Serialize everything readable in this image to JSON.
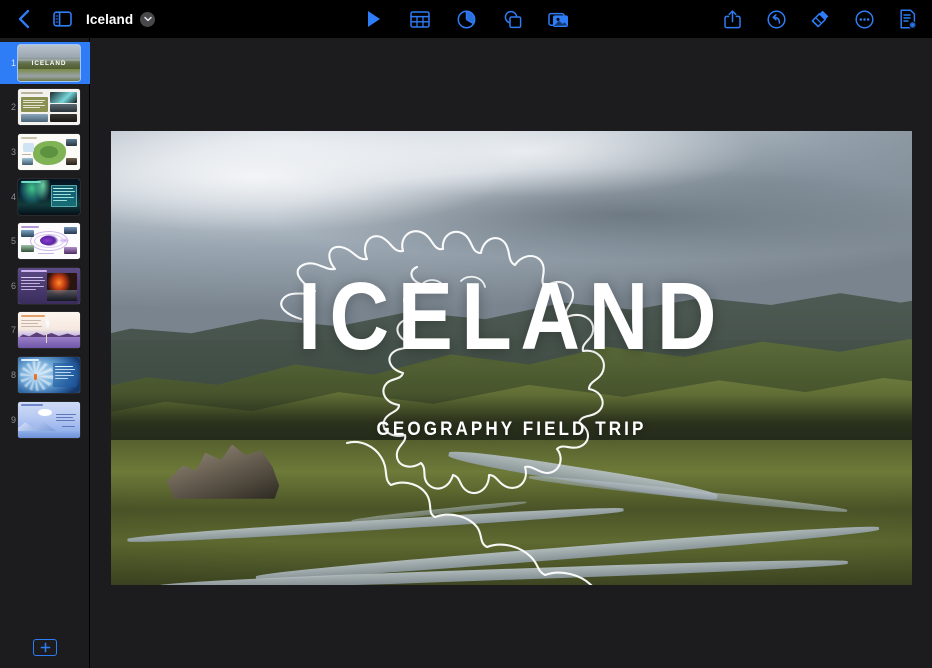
{
  "app": {
    "name": "Keynote",
    "background_color": "#1c1c1e",
    "toolbar_color": "#000000",
    "accent_color": "#2e7cf6"
  },
  "toolbar": {
    "back_label": "Back",
    "back_icon": "chevron-left-icon",
    "sidebar_toggle_icon": "sidebar-panel-icon",
    "document_title": "Iceland",
    "title_chevron_icon": "chevron-down-icon",
    "center_tools": [
      {
        "name": "play-button",
        "icon": "play-triangle-icon",
        "label": "Play"
      },
      {
        "name": "insert-table-button",
        "icon": "table-grid-icon",
        "label": "Table"
      },
      {
        "name": "insert-chart-button",
        "icon": "pie-chart-icon",
        "label": "Chart"
      },
      {
        "name": "insert-shape-button",
        "icon": "shapes-icon",
        "label": "Shape"
      },
      {
        "name": "insert-media-button",
        "icon": "media-photo-icon",
        "label": "Media"
      }
    ],
    "right_tools": [
      {
        "name": "share-button",
        "icon": "share-box-arrow-up-icon",
        "label": "Share"
      },
      {
        "name": "undo-button",
        "icon": "undo-arrow-circle-icon",
        "label": "Undo"
      },
      {
        "name": "format-button",
        "icon": "paintbrush-icon",
        "label": "Format"
      },
      {
        "name": "more-button",
        "icon": "ellipsis-circle-icon",
        "label": "More"
      },
      {
        "name": "document-options-button",
        "icon": "document-badge-icon",
        "label": "Document"
      }
    ]
  },
  "sidebar": {
    "add_slide_label": "+",
    "add_slide_icon": "plus-icon",
    "selected_slide": 1,
    "slides": [
      {
        "number": "1",
        "title": "ICELAND",
        "theme": "photo-title",
        "selected": true
      },
      {
        "number": "2",
        "theme": "light-text-photos",
        "selected": false
      },
      {
        "number": "3",
        "theme": "map-white",
        "selected": false
      },
      {
        "number": "4",
        "theme": "aurora-teal",
        "selected": false
      },
      {
        "number": "5",
        "theme": "diagram-purple",
        "selected": false
      },
      {
        "number": "6",
        "theme": "volcano-purple",
        "selected": false
      },
      {
        "number": "7",
        "theme": "geyser-lavender",
        "selected": false
      },
      {
        "number": "8",
        "theme": "glacier-blue",
        "selected": false
      },
      {
        "number": "9",
        "theme": "iceberg-pale",
        "selected": false
      }
    ]
  },
  "slide": {
    "title": "ICELAND",
    "subtitle": "GEOGRAPHY FIELD TRIP",
    "overlay_graphic": "iceland-map-outline",
    "background": "iceland-highlands-photo"
  }
}
